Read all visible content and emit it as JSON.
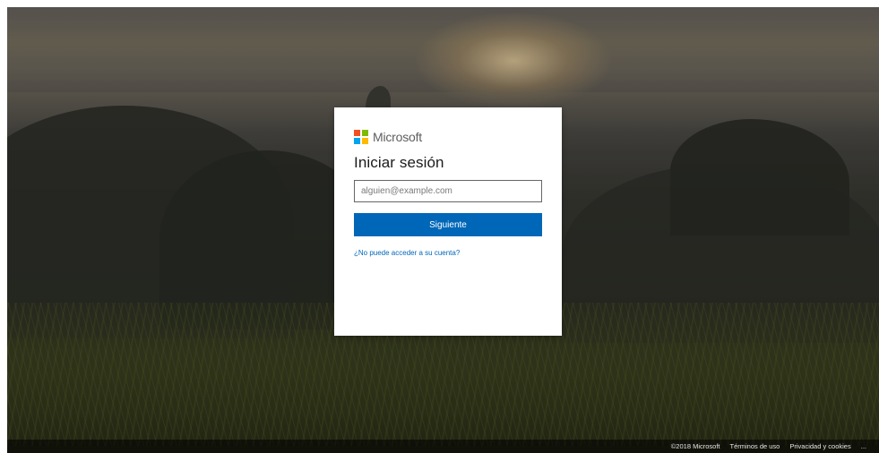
{
  "brand": {
    "name": "Microsoft",
    "logo_colors": [
      "#f25022",
      "#7fba00",
      "#00a4ef",
      "#ffb900"
    ]
  },
  "signin": {
    "title": "Iniciar sesión",
    "email_placeholder": "alguien@example.com",
    "email_value": "",
    "next_label": "Siguiente",
    "help_link": "¿No puede acceder a su cuenta?"
  },
  "footer": {
    "copyright": "©2018 Microsoft",
    "terms": "Términos de uso",
    "privacy": "Privacidad y cookies",
    "more": "..."
  },
  "colors": {
    "primary": "#0067b8",
    "card_bg": "#ffffff"
  }
}
